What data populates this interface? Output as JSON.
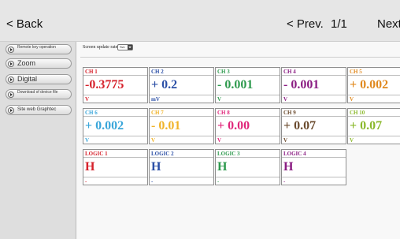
{
  "header": {
    "back_label": "< Back",
    "prev_label": "< Prev.",
    "page_indicator": "1/1",
    "next_label": "Next"
  },
  "sidebar": {
    "items": [
      {
        "label": "Remote key operation",
        "small": true
      },
      {
        "label": "Zoom",
        "small": false
      },
      {
        "label": "Digital",
        "small": false
      },
      {
        "label": "Download of device file",
        "small": true
      },
      {
        "label": "Site web Graphtec",
        "small": false
      }
    ]
  },
  "controls": {
    "update_rate_label": "Screen update rate",
    "update_rate_value": "5sec"
  },
  "channels": [
    {
      "name": "CH 1",
      "value": "-0.3775",
      "unit": "V",
      "color": "#d6212b"
    },
    {
      "name": "CH 2",
      "value": "+ 0.2",
      "unit": "mV",
      "color": "#2b4fa6"
    },
    {
      "name": "CH 3",
      "value": "- 0.001",
      "unit": "V",
      "color": "#2e9a4e"
    },
    {
      "name": "CH 4",
      "value": "- 0.001",
      "unit": "V",
      "color": "#8a1c82"
    },
    {
      "name": "CH 5",
      "value": "+ 0.002",
      "unit": "V",
      "color": "#e0891e"
    },
    {
      "name": "CH 6",
      "value": "+ 0.002",
      "unit": "V",
      "color": "#3aa6da"
    },
    {
      "name": "CH 7",
      "value": "- 0.01",
      "unit": "V",
      "color": "#f0b329"
    },
    {
      "name": "CH 8",
      "value": "+ 0.00",
      "unit": "V",
      "color": "#e0267a"
    },
    {
      "name": "CH 9",
      "value": "+ 0.07",
      "unit": "V",
      "color": "#6b4b2e"
    },
    {
      "name": "CH 10",
      "value": "+ 0.07",
      "unit": "V",
      "color": "#8ab82a"
    }
  ],
  "logic": [
    {
      "name": "LOGIC 1",
      "value": "H",
      "unit": "-",
      "color": "#d6212b"
    },
    {
      "name": "LOGIC 2",
      "value": "H",
      "unit": "-",
      "color": "#2b4fa6"
    },
    {
      "name": "LOGIC 3",
      "value": "H",
      "unit": "-",
      "color": "#2e9a4e"
    },
    {
      "name": "LOGIC 4",
      "value": "H",
      "unit": "-",
      "color": "#8a1c82"
    }
  ]
}
